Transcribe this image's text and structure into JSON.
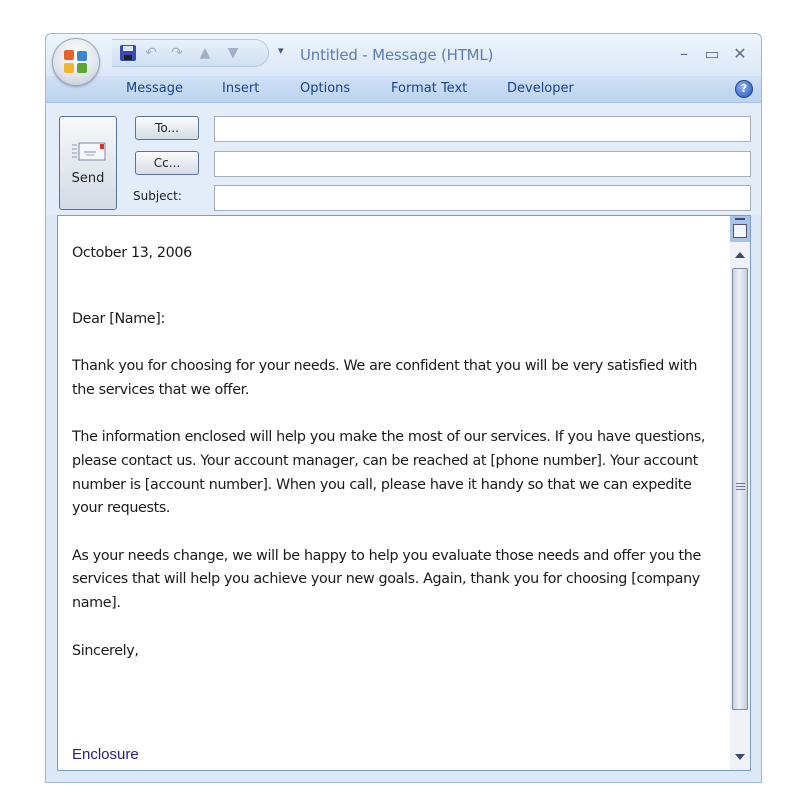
{
  "window": {
    "title": "Untitled - Message (HTML)",
    "quick_access": [
      "save-icon",
      "undo-icon",
      "redo-icon",
      "previous-item-icon",
      "next-item-icon",
      "customize-toolbar-icon"
    ],
    "controls": {
      "minimize": "–",
      "maximize": "▭",
      "close": "✕"
    }
  },
  "tabs": [
    {
      "label": "Message"
    },
    {
      "label": "Insert"
    },
    {
      "label": "Options"
    },
    {
      "label": "Format Text"
    },
    {
      "label": "Developer"
    }
  ],
  "help_label": "?",
  "header": {
    "send_label": "Send",
    "to_label": "To...",
    "cc_label": "Cc...",
    "subject_label": "Subject:",
    "to_value": "",
    "cc_value": "",
    "subject_value": ""
  },
  "body": {
    "date": "October 13, 2006",
    "salutation": "Dear [Name]:",
    "paragraphs": [
      "Thank you for choosing for your needs. We are confident that you will be very satisfied with the services that we offer.",
      "The information enclosed will help you make the most of our services. If you have questions, please contact us. Your account manager, can be reached at [phone number]. Your account number is [account number]. When you call, please have it handy so that we can expedite your requests.",
      "As your needs change, we will be happy to help you evaluate those needs and offer you the services that will help you achieve your new goals. Again, thank you for choosing [company name]."
    ],
    "closing": "Sincerely,",
    "enclosure": "Enclosure"
  },
  "colors": {
    "tab_text": "#15428b",
    "title_text": "#5b7fb0",
    "enclosure_text": "#2d1a7a",
    "frame": "#dbe8f8"
  }
}
